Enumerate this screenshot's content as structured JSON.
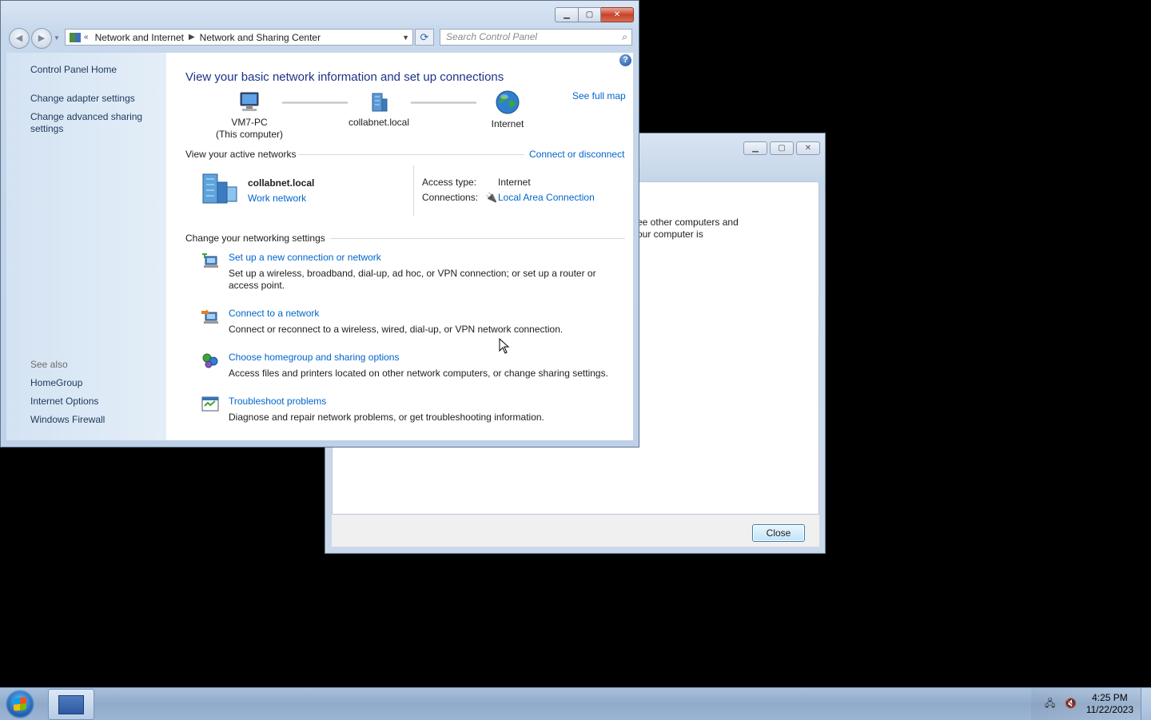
{
  "back_dialog": {
    "peek_line1": "see other computers and",
    "peek_line2": "your computer is",
    "close_label": "Close"
  },
  "window": {
    "breadcrumb": [
      "Network and Internet",
      "Network and Sharing Center"
    ],
    "search_placeholder": "Search Control Panel"
  },
  "sidebar": {
    "home": "Control Panel Home",
    "adapter": "Change adapter settings",
    "advanced_line1": "Change advanced sharing",
    "advanced_line2": "settings",
    "see_also": "See also",
    "homegroup": "HomeGroup",
    "internet_options": "Internet Options",
    "firewall": "Windows Firewall"
  },
  "main": {
    "title": "View your basic network information and set up connections",
    "see_full_map": "See full map",
    "nodes": {
      "pc_name": "VM7-PC",
      "pc_sub": "(This computer)",
      "network": "collabnet.local",
      "internet": "Internet"
    },
    "active_header": "View your active networks",
    "connect_disconnect": "Connect or disconnect",
    "active": {
      "name": "collabnet.local",
      "type": "Work network",
      "access_label": "Access type:",
      "access_value": "Internet",
      "conn_label": "Connections:",
      "conn_value": "Local Area Connection"
    },
    "change_header": "Change your networking settings",
    "settings": [
      {
        "title": "Set up a new connection or network",
        "desc": "Set up a wireless, broadband, dial-up, ad hoc, or VPN connection; or set up a router or access point."
      },
      {
        "title": "Connect to a network",
        "desc": "Connect or reconnect to a wireless, wired, dial-up, or VPN network connection."
      },
      {
        "title": "Choose homegroup and sharing options",
        "desc": "Access files and printers located on other network computers, or change sharing settings."
      },
      {
        "title": "Troubleshoot problems",
        "desc": "Diagnose and repair network problems, or get troubleshooting information."
      }
    ]
  },
  "taskbar": {
    "time": "4:25 PM",
    "date": "11/22/2023"
  }
}
